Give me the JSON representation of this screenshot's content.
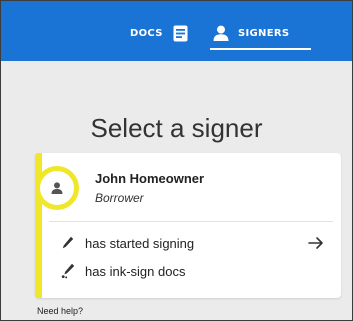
{
  "nav": {
    "tabs": [
      {
        "label": "DOCS",
        "icon": "document-icon",
        "active": false
      },
      {
        "label": "SIGNERS",
        "icon": "person-icon",
        "active": true
      }
    ]
  },
  "page": {
    "title": "Select a signer"
  },
  "signer": {
    "name": "John Homeowner",
    "role": "Borrower",
    "statuses": [
      {
        "text": "has started signing",
        "icon": "pen-icon"
      },
      {
        "text": "has ink-sign docs",
        "icon": "ink-pen-icon"
      }
    ]
  },
  "footer": {
    "help_text": "Need help?"
  },
  "colors": {
    "header_bg": "#1a74d6",
    "accent_yellow": "#f0e62a",
    "page_bg": "#ebebeb"
  }
}
